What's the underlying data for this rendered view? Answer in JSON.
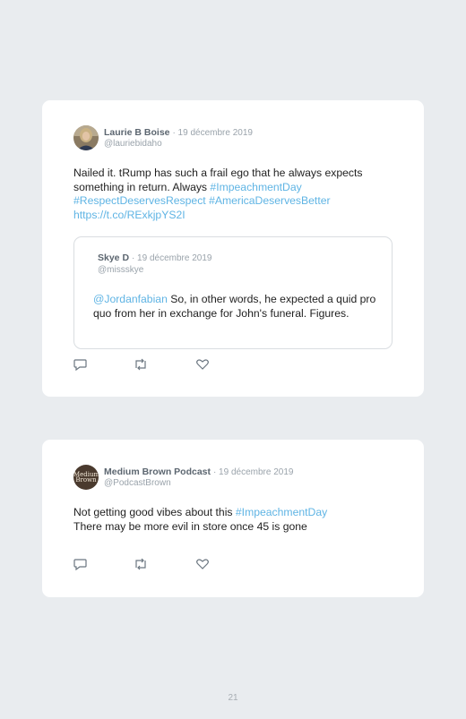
{
  "tweets": [
    {
      "author": "Laurie B Boise",
      "date": "· 19 décembre 2019",
      "handle": "@lauriebidaho",
      "text_plain": "Nailed it. tRump has such a frail ego that he always expects something in return. Always ",
      "hashtag1": "#ImpeachmentDay",
      "hashtag2": "#RespectDeservesRespect",
      "hashtag3": "#AmericaDeservesBetter",
      "url": "https://t.co/RExkjpYS2I",
      "quoted": {
        "author": "Skye D",
        "date": "· 19 décembre 2019",
        "handle": "@missskye",
        "mention": "@Jordanfabian",
        "text": " So, in other words, he expected a quid pro quo from her in exchange for John's funeral. Figures."
      }
    },
    {
      "author": "Medium Brown Podcast",
      "date": "· 19 décembre 2019",
      "handle": "@PodcastBrown",
      "avatar_text": "Medium Brown",
      "text_plain": "Not getting good vibes about this ",
      "hashtag1": "#ImpeachmentDay",
      "text_line2": "There may be more evil in store once 45 is gone"
    }
  ],
  "icons": [
    "reply-icon",
    "retweet-icon",
    "like-icon"
  ],
  "page_number": "21"
}
